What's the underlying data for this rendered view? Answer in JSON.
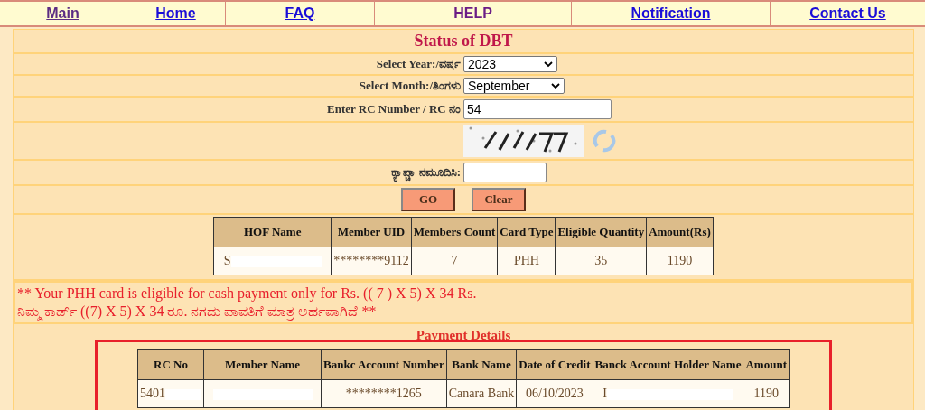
{
  "nav": [
    {
      "label": "Main",
      "kind": "visited"
    },
    {
      "label": "Home",
      "kind": "link"
    },
    {
      "label": "FAQ",
      "kind": "link"
    },
    {
      "label": "HELP",
      "kind": "plain"
    },
    {
      "label": "Notification",
      "kind": "link"
    },
    {
      "label": "Contact Us",
      "kind": "link"
    }
  ],
  "title": "Status of DBT",
  "form": [
    {
      "kind": "select",
      "label": "Select Year:/ವರ್ಷ",
      "value": "2023"
    },
    {
      "kind": "select",
      "label": "Select Month:/ತಿಂಗಳು",
      "value": "September"
    },
    {
      "kind": "input",
      "label": "Enter RC Number  / RC ನಂ",
      "value": "54"
    },
    {
      "kind": "captcha"
    },
    {
      "kind": "input",
      "label": "ಕ್ಯಾಪ್ಚಾ ನಮೂದಿಸಿ:"
    }
  ],
  "buttons": [
    "GO",
    "Clear"
  ],
  "hof_table": {
    "columns": [
      "HOF Name",
      "Member UID",
      "Members Count",
      "Card Type",
      "Eligible Quantity",
      "Amount(Rs)"
    ],
    "rows": [
      [
        {
          "text": "S",
          "redacted": true
        },
        {
          "text": "********9112",
          "redacted": false
        },
        {
          "text": "7",
          "redacted": false
        },
        {
          "text": "PHH",
          "redacted": false
        },
        {
          "text": "35",
          "redacted": false
        },
        {
          "text": "1190",
          "redacted": false
        }
      ]
    ]
  },
  "messages": [
    "** Your PHH card is eligible for cash payment only for Rs. (( 7 ) X 5) X 34 Rs.",
    "ನಿಮ್ಮ ಕಾರ್ಡ್ ((7) X 5) X 34 ರೂ. ನಗದು ಪಾವತಿಗೆ ಮಾತ್ರ ಅರ್ಹವಾಗಿದೆ **"
  ],
  "payment": {
    "title": "Payment Details",
    "highlighted": true,
    "columns": [
      "RC No",
      "Member Name",
      "Bankc Account Number",
      "Bank Name",
      "Date of Credit",
      "Banck Account Holder Name",
      "Amount"
    ],
    "rows": [
      [
        {
          "text": "5401",
          "redacted": true
        },
        {
          "redacted": true
        },
        {
          "text": "********1265",
          "redacted": false
        },
        {
          "text": "Canara Bank",
          "redacted": false
        },
        {
          "text": "06/10/2023",
          "redacted": false
        },
        {
          "text": "I",
          "redacted": true
        },
        {
          "text": "1190",
          "redacted": false
        }
      ]
    ]
  }
}
